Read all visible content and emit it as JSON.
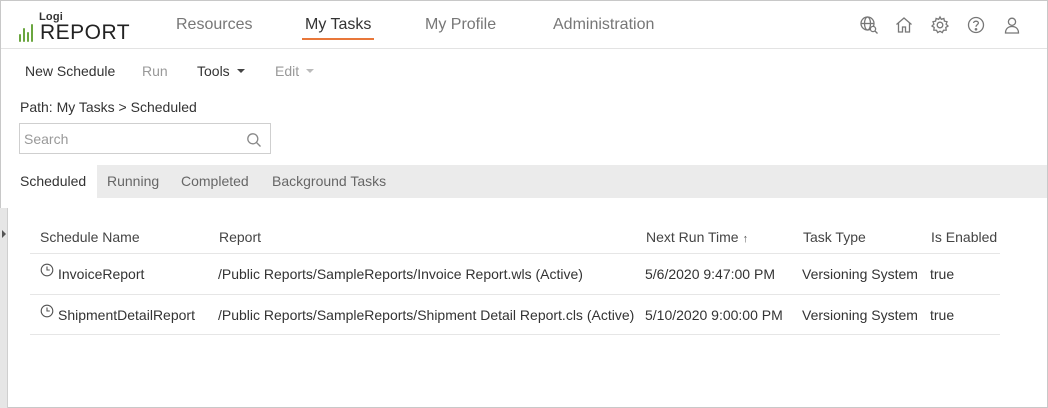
{
  "logo": {
    "small": "Logi",
    "large": "REPORT"
  },
  "nav": {
    "items": [
      {
        "label": "Resources"
      },
      {
        "label": "My Tasks",
        "active": true
      },
      {
        "label": "My Profile"
      },
      {
        "label": "Administration"
      }
    ],
    "icons": [
      "globe-search-icon",
      "home-icon",
      "gear-icon",
      "help-icon",
      "user-icon"
    ]
  },
  "toolbar": {
    "new_schedule": "New Schedule",
    "run": "Run",
    "tools": "Tools",
    "edit": "Edit"
  },
  "path": "Path: My Tasks > Scheduled",
  "search": {
    "placeholder": "Search",
    "value": ""
  },
  "tabs": [
    {
      "label": "Scheduled",
      "active": true
    },
    {
      "label": "Running"
    },
    {
      "label": "Completed"
    },
    {
      "label": "Background Tasks"
    }
  ],
  "table": {
    "columns": [
      "Schedule Name",
      "Report",
      "Next Run Time",
      "Task Type",
      "Is Enabled"
    ],
    "sort_indicator": "↑",
    "rows": [
      {
        "name": "InvoiceReport",
        "report": "/Public Reports/SampleReports/Invoice Report.wls (Active)",
        "next_run": "5/6/2020 9:47:00 PM",
        "task_type": "Versioning System",
        "enabled": "true"
      },
      {
        "name": "ShipmentDetailReport",
        "report": "/Public Reports/SampleReports/Shipment Detail Report.cls (Active)",
        "next_run": "5/10/2020 9:00:00 PM",
        "task_type": "Versioning System",
        "enabled": "true"
      }
    ]
  },
  "colors": {
    "accent": "#e8773a",
    "logo_green": "#6aa63f",
    "tabbar": "#ebebeb"
  }
}
